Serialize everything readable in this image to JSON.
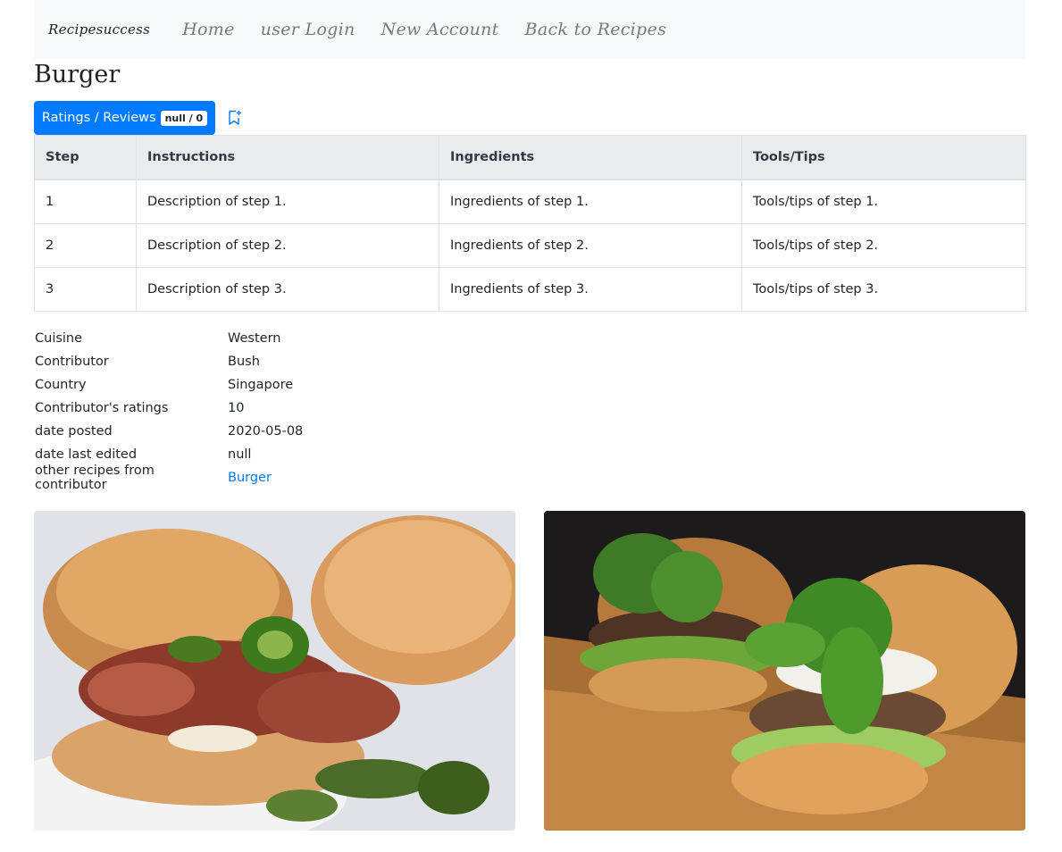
{
  "navbar": {
    "brand": "Recipesuccess",
    "links": [
      "Home",
      "user Login",
      "New Account",
      "Back to Recipes"
    ]
  },
  "recipe": {
    "title": "Burger",
    "ratings_label": "Ratings / Reviews",
    "ratings_badge": "null / 0",
    "bookmark_icon": "bookmark-plus-icon"
  },
  "table": {
    "headers": [
      "Step",
      "Instructions",
      "Ingredients",
      "Tools/Tips"
    ],
    "rows": [
      [
        "1",
        "Description of step 1.",
        "Ingredients of step 1.",
        "Tools/tips of step 1."
      ],
      [
        "2",
        "Description of step 2.",
        "Ingredients of step 2.",
        "Tools/tips of step 2."
      ],
      [
        "3",
        "Description of step 3.",
        "Ingredients of step 3.",
        "Tools/tips of step 3."
      ]
    ]
  },
  "details": [
    {
      "label": "Cuisine",
      "value": "Western"
    },
    {
      "label": "Contributor",
      "value": "Bush"
    },
    {
      "label": "Country",
      "value": "Singapore"
    },
    {
      "label": "Contributor's ratings",
      "value": "10"
    },
    {
      "label": "date posted",
      "value": "2020-05-08"
    },
    {
      "label": "date last edited",
      "value": "null"
    },
    {
      "label": "other recipes from contributor",
      "value": "Burger"
    }
  ],
  "colors": {
    "primary": "#007bff",
    "navbar_bg": "#f8f9fa",
    "table_header_bg": "#e9ecef"
  }
}
